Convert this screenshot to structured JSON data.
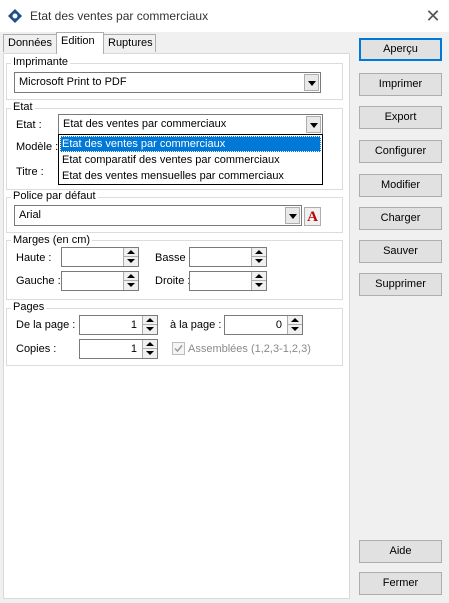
{
  "window": {
    "title": "Etat des ventes par commerciaux",
    "close_icon": "close-icon"
  },
  "tabs": [
    {
      "label": "Données",
      "active": false
    },
    {
      "label": "Edition",
      "active": true
    },
    {
      "label": "Ruptures",
      "active": false
    }
  ],
  "printer": {
    "group_title": "Imprimante",
    "selected": "Microsoft Print to PDF"
  },
  "etat": {
    "group_title": "Etat",
    "etat_label": "Etat :",
    "etat_value": "Etat des ventes par commerciaux",
    "modele_label": "Modèle :",
    "titre_label": "Titre :",
    "dropdown_options": [
      "Etat des ventes par commerciaux",
      "Etat comparatif des ventes par commerciaux",
      "Etat des ventes mensuelles par commerciaux"
    ],
    "selected_index": 0
  },
  "font": {
    "group_title": "Police par défaut",
    "value": "Arial",
    "font_button": "A"
  },
  "margins": {
    "group_title": "Marges (en cm)",
    "haute_label": "Haute :",
    "haute_value": "",
    "basse_label": "Basse :",
    "basse_value": "",
    "gauche_label": "Gauche :",
    "gauche_value": "",
    "droite_label": "Droite :",
    "droite_value": ""
  },
  "pages": {
    "group_title": "Pages",
    "from_label": "De la page :",
    "from_value": "1",
    "to_label": "à la page :",
    "to_value": "0",
    "copies_label": "Copies :",
    "copies_value": "1",
    "collate_label": "Assemblées (1,2,3-1,2,3)",
    "collate_checked": true
  },
  "buttons": {
    "apercu": "Aperçu",
    "imprimer": "Imprimer",
    "export": "Export",
    "configurer": "Configurer",
    "modifier": "Modifier",
    "charger": "Charger",
    "sauver": "Sauver",
    "supprimer": "Supprimer",
    "aide": "Aide",
    "fermer": "Fermer"
  },
  "colors": {
    "accent": "#0078d7",
    "selection_bg": "#0078d7",
    "window_bg": "#f0f0f0"
  }
}
